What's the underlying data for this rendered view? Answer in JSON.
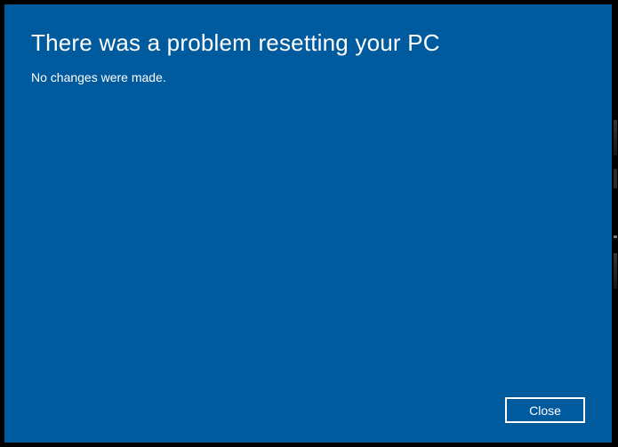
{
  "dialog": {
    "title": "There was a problem resetting your PC",
    "message": "No changes were made.",
    "close_label": "Close"
  }
}
